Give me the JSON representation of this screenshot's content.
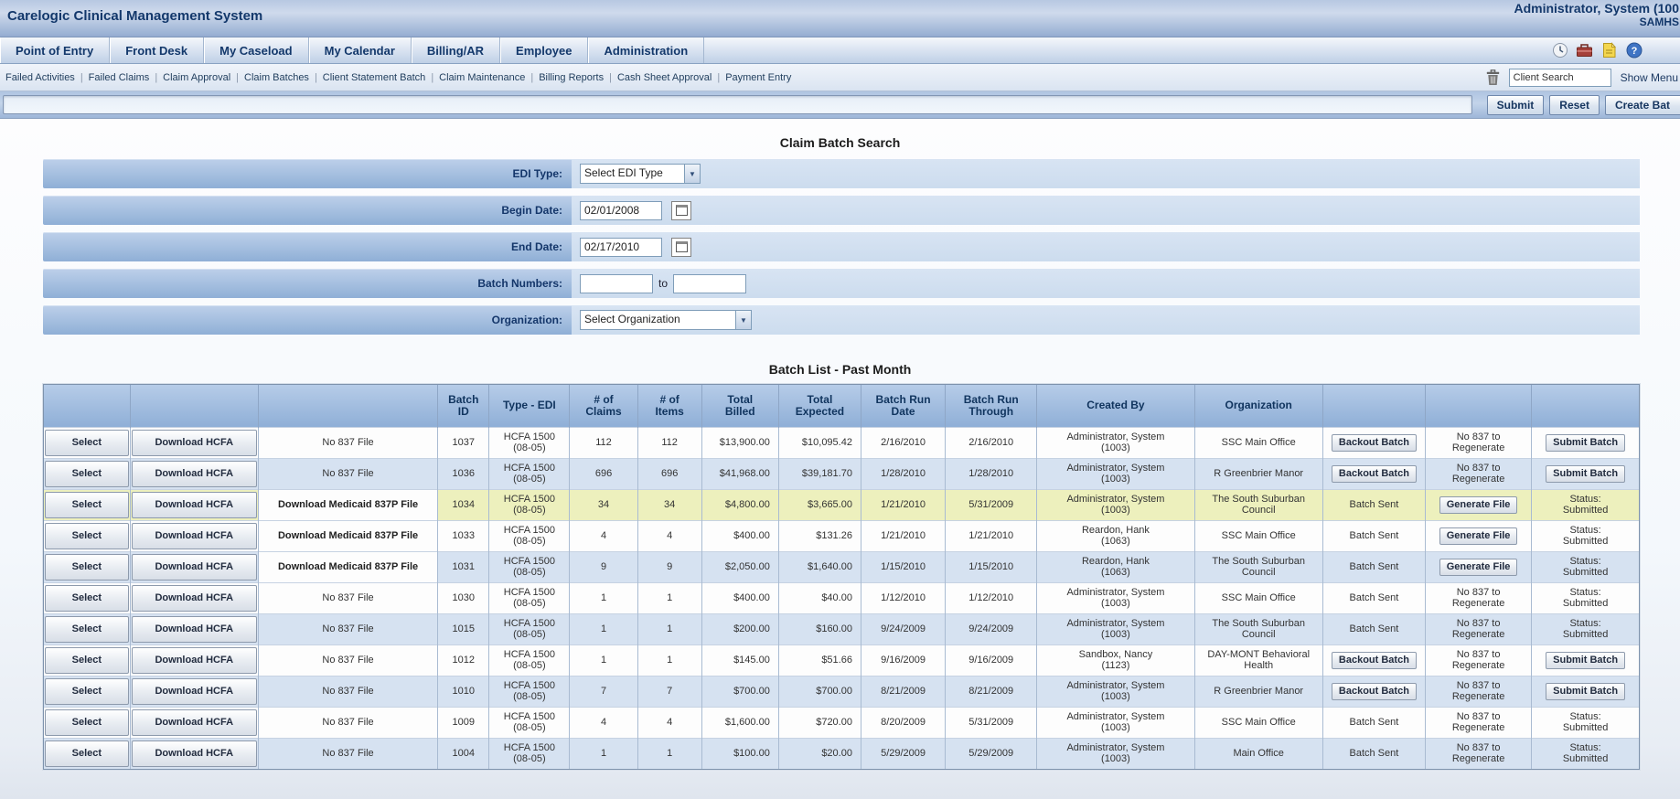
{
  "titlebar": {
    "app_title": "Carelogic Clinical Management System",
    "user_name": "Administrator, System (100",
    "org_code": "SAMHS"
  },
  "nav": {
    "tabs": [
      "Point of Entry",
      "Front Desk",
      "My Caseload",
      "My Calendar",
      "Billing/AR",
      "Employee",
      "Administration"
    ]
  },
  "quick_icons": [
    "clock-icon",
    "briefcase-icon",
    "note-icon",
    "help-icon"
  ],
  "subnav": {
    "links": [
      "Failed Activities",
      "Failed Claims",
      "Claim Approval",
      "Claim Batches",
      "Client Statement Batch",
      "Claim Maintenance",
      "Billing Reports",
      "Cash Sheet Approval",
      "Payment Entry"
    ],
    "client_search_value": "Client Search",
    "show_menu_label": "Show Menu"
  },
  "action_bar": {
    "submit_label": "Submit",
    "reset_label": "Reset",
    "create_batch_label": "Create Bat"
  },
  "claim_batch_search": {
    "title": "Claim Batch Search",
    "edi_type": {
      "label": "EDI Type:",
      "value": "Select EDI Type"
    },
    "begin_date": {
      "label": "Begin Date:",
      "value": "02/01/2008"
    },
    "end_date": {
      "label": "End Date:",
      "value": "02/17/2010"
    },
    "batch_numbers": {
      "label": "Batch Numbers:",
      "from_value": "",
      "to_word": "to",
      "to_value": ""
    },
    "organization": {
      "label": "Organization:",
      "value": "Select Organization"
    }
  },
  "batch_list": {
    "title": "Batch List - Past Month",
    "columns": [
      "",
      "",
      "",
      "Batch\nID",
      "Type - EDI",
      "# of\nClaims",
      "# of\nItems",
      "Total\nBilled",
      "Total\nExpected",
      "Batch Run\nDate",
      "Batch Run\nThrough",
      "Created By",
      "Organization",
      "",
      "",
      ""
    ],
    "rows": [
      {
        "select_label": "Select",
        "download_label": "Download HCFA",
        "file_837": {
          "label": "No 837 File",
          "kind": "text"
        },
        "batch_id": "1037",
        "type_edi": "HCFA 1500\n(08-05)",
        "claims": "112",
        "items": "112",
        "billed": "$13,900.00",
        "expected": "$10,095.42",
        "run_date": "2/16/2010",
        "run_through": "2/16/2010",
        "created_by": "Administrator, System\n(1003)",
        "organization": "SSC Main Office",
        "action1": {
          "label": "Backout Batch",
          "kind": "button"
        },
        "action2": {
          "label": "No 837 to\nRegenerate",
          "kind": "text"
        },
        "action3": {
          "label": "Submit Batch",
          "kind": "button"
        },
        "highlight": false
      },
      {
        "select_label": "Select",
        "download_label": "Download HCFA",
        "file_837": {
          "label": "No 837 File",
          "kind": "text"
        },
        "batch_id": "1036",
        "type_edi": "HCFA 1500\n(08-05)",
        "claims": "696",
        "items": "696",
        "billed": "$41,968.00",
        "expected": "$39,181.70",
        "run_date": "1/28/2010",
        "run_through": "1/28/2010",
        "created_by": "Administrator, System\n(1003)",
        "organization": "R Greenbrier Manor",
        "action1": {
          "label": "Backout Batch",
          "kind": "button"
        },
        "action2": {
          "label": "No 837 to\nRegenerate",
          "kind": "text"
        },
        "action3": {
          "label": "Submit Batch",
          "kind": "button"
        },
        "highlight": false
      },
      {
        "select_label": "Select",
        "download_label": "Download HCFA",
        "file_837": {
          "label": "Download Medicaid 837P File",
          "kind": "link"
        },
        "batch_id": "1034",
        "type_edi": "HCFA 1500\n(08-05)",
        "claims": "34",
        "items": "34",
        "billed": "$4,800.00",
        "expected": "$3,665.00",
        "run_date": "1/21/2010",
        "run_through": "5/31/2009",
        "created_by": "Administrator, System\n(1003)",
        "organization": "The South Suburban\nCouncil",
        "action1": {
          "label": "Batch Sent",
          "kind": "text"
        },
        "action2": {
          "label": "Generate File",
          "kind": "button"
        },
        "action3": {
          "label": "Status:\nSubmitted",
          "kind": "text"
        },
        "highlight": true
      },
      {
        "select_label": "Select",
        "download_label": "Download HCFA",
        "file_837": {
          "label": "Download Medicaid 837P File",
          "kind": "link"
        },
        "batch_id": "1033",
        "type_edi": "HCFA 1500\n(08-05)",
        "claims": "4",
        "items": "4",
        "billed": "$400.00",
        "expected": "$131.26",
        "run_date": "1/21/2010",
        "run_through": "1/21/2010",
        "created_by": "Reardon, Hank\n(1063)",
        "organization": "SSC Main Office",
        "action1": {
          "label": "Batch Sent",
          "kind": "text"
        },
        "action2": {
          "label": "Generate File",
          "kind": "button"
        },
        "action3": {
          "label": "Status:\nSubmitted",
          "kind": "text"
        },
        "highlight": false
      },
      {
        "select_label": "Select",
        "download_label": "Download HCFA",
        "file_837": {
          "label": "Download Medicaid 837P File",
          "kind": "link"
        },
        "batch_id": "1031",
        "type_edi": "HCFA 1500\n(08-05)",
        "claims": "9",
        "items": "9",
        "billed": "$2,050.00",
        "expected": "$1,640.00",
        "run_date": "1/15/2010",
        "run_through": "1/15/2010",
        "created_by": "Reardon, Hank\n(1063)",
        "organization": "The South Suburban\nCouncil",
        "action1": {
          "label": "Batch Sent",
          "kind": "text"
        },
        "action2": {
          "label": "Generate File",
          "kind": "button"
        },
        "action3": {
          "label": "Status:\nSubmitted",
          "kind": "text"
        },
        "highlight": false
      },
      {
        "select_label": "Select",
        "download_label": "Download HCFA",
        "file_837": {
          "label": "No 837 File",
          "kind": "text"
        },
        "batch_id": "1030",
        "type_edi": "HCFA 1500\n(08-05)",
        "claims": "1",
        "items": "1",
        "billed": "$400.00",
        "expected": "$40.00",
        "run_date": "1/12/2010",
        "run_through": "1/12/2010",
        "created_by": "Administrator, System\n(1003)",
        "organization": "SSC Main Office",
        "action1": {
          "label": "Batch Sent",
          "kind": "text"
        },
        "action2": {
          "label": "No 837 to\nRegenerate",
          "kind": "text"
        },
        "action3": {
          "label": "Status:\nSubmitted",
          "kind": "text"
        },
        "highlight": false
      },
      {
        "select_label": "Select",
        "download_label": "Download HCFA",
        "file_837": {
          "label": "No 837 File",
          "kind": "text"
        },
        "batch_id": "1015",
        "type_edi": "HCFA 1500\n(08-05)",
        "claims": "1",
        "items": "1",
        "billed": "$200.00",
        "expected": "$160.00",
        "run_date": "9/24/2009",
        "run_through": "9/24/2009",
        "created_by": "Administrator, System\n(1003)",
        "organization": "The South Suburban\nCouncil",
        "action1": {
          "label": "Batch Sent",
          "kind": "text"
        },
        "action2": {
          "label": "No 837 to\nRegenerate",
          "kind": "text"
        },
        "action3": {
          "label": "Status:\nSubmitted",
          "kind": "text"
        },
        "highlight": false
      },
      {
        "select_label": "Select",
        "download_label": "Download HCFA",
        "file_837": {
          "label": "No 837 File",
          "kind": "text"
        },
        "batch_id": "1012",
        "type_edi": "HCFA 1500\n(08-05)",
        "claims": "1",
        "items": "1",
        "billed": "$145.00",
        "expected": "$51.66",
        "run_date": "9/16/2009",
        "run_through": "9/16/2009",
        "created_by": "Sandbox, Nancy\n(1123)",
        "organization": "DAY-MONT Behavioral\nHealth",
        "action1": {
          "label": "Backout Batch",
          "kind": "button"
        },
        "action2": {
          "label": "No 837 to\nRegenerate",
          "kind": "text"
        },
        "action3": {
          "label": "Submit Batch",
          "kind": "button"
        },
        "highlight": false
      },
      {
        "select_label": "Select",
        "download_label": "Download HCFA",
        "file_837": {
          "label": "No 837 File",
          "kind": "text"
        },
        "batch_id": "1010",
        "type_edi": "HCFA 1500\n(08-05)",
        "claims": "7",
        "items": "7",
        "billed": "$700.00",
        "expected": "$700.00",
        "run_date": "8/21/2009",
        "run_through": "8/21/2009",
        "created_by": "Administrator, System\n(1003)",
        "organization": "R Greenbrier Manor",
        "action1": {
          "label": "Backout Batch",
          "kind": "button"
        },
        "action2": {
          "label": "No 837 to\nRegenerate",
          "kind": "text"
        },
        "action3": {
          "label": "Submit Batch",
          "kind": "button"
        },
        "highlight": false
      },
      {
        "select_label": "Select",
        "download_label": "Download HCFA",
        "file_837": {
          "label": "No 837 File",
          "kind": "text"
        },
        "batch_id": "1009",
        "type_edi": "HCFA 1500\n(08-05)",
        "claims": "4",
        "items": "4",
        "billed": "$1,600.00",
        "expected": "$720.00",
        "run_date": "8/20/2009",
        "run_through": "5/31/2009",
        "created_by": "Administrator, System\n(1003)",
        "organization": "SSC Main Office",
        "action1": {
          "label": "Batch Sent",
          "kind": "text"
        },
        "action2": {
          "label": "No 837 to\nRegenerate",
          "kind": "text"
        },
        "action3": {
          "label": "Status:\nSubmitted",
          "kind": "text"
        },
        "highlight": false
      },
      {
        "select_label": "Select",
        "download_label": "Download HCFA",
        "file_837": {
          "label": "No 837 File",
          "kind": "text"
        },
        "batch_id": "1004",
        "type_edi": "HCFA 1500\n(08-05)",
        "claims": "1",
        "items": "1",
        "billed": "$100.00",
        "expected": "$20.00",
        "run_date": "5/29/2009",
        "run_through": "5/29/2009",
        "created_by": "Administrator, System\n(1003)",
        "organization": "Main Office",
        "action1": {
          "label": "Batch Sent",
          "kind": "text"
        },
        "action2": {
          "label": "No 837 to\nRegenerate",
          "kind": "text"
        },
        "action3": {
          "label": "Status:\nSubmitted",
          "kind": "text"
        },
        "highlight": false
      }
    ]
  }
}
